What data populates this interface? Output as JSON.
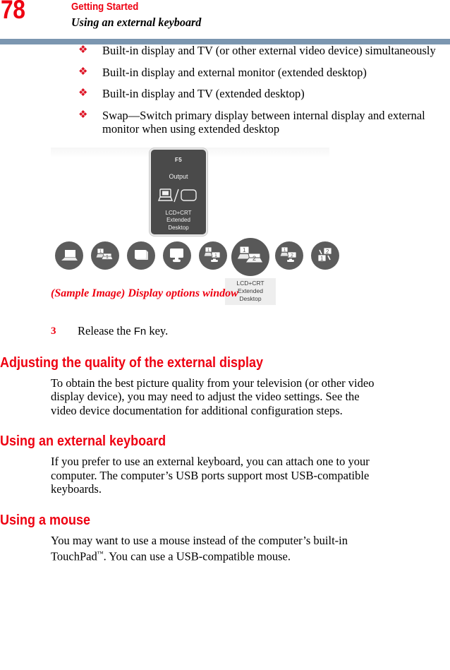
{
  "header": {
    "page_number": "78",
    "chapter": "Getting Started",
    "section": "Using an external keyboard",
    "rule_color": "#7b96b0",
    "accent_color": "#ee0011"
  },
  "bullets": [
    {
      "text": "Built-in display and TV (or other external video device) simultaneously"
    },
    {
      "text": "Built-in display and external monitor (extended desktop)"
    },
    {
      "text": "Built-in display and TV (extended desktop)"
    },
    {
      "text": "Swap—Switch primary display between internal display and external monitor when using extended desktop"
    }
  ],
  "figure": {
    "panel": {
      "key_label": "F5",
      "title": "Output",
      "mode_line1": "LCD+CRT",
      "mode_line2": "Extended",
      "mode_line3": "Desktop"
    },
    "icons": [
      {
        "name": "laptop-only-icon",
        "selected": false
      },
      {
        "name": "laptop-and-monitor-clone-icon",
        "selected": false
      },
      {
        "name": "monitor-only-icon",
        "selected": false
      },
      {
        "name": "tv-only-icon",
        "selected": false
      },
      {
        "name": "laptop-and-tv-clone-icon",
        "selected": false
      },
      {
        "name": "laptop-and-monitor-extended-icon",
        "selected": true
      },
      {
        "name": "laptop-and-tv-extended-icon",
        "selected": false
      },
      {
        "name": "swap-displays-icon",
        "selected": false
      }
    ],
    "tooltip": {
      "line1": "LCD+CRT",
      "line2": "Extended",
      "line3": "Desktop"
    },
    "caption": "(Sample Image) Display options window"
  },
  "step": {
    "number": "3",
    "text_before": "Release the ",
    "key": "Fn",
    "text_after": " key."
  },
  "sections": [
    {
      "heading": "Adjusting the quality of the external display",
      "body": "To obtain the best picture quality from your television (or other video display device), you may need to adjust the video settings. See the video device documentation for additional configuration steps."
    },
    {
      "heading": "Using an external keyboard",
      "body": "If you prefer to use an external keyboard, you can attach one to your computer. The computer’s USB ports support most USB-compatible keyboards."
    },
    {
      "heading": "Using a mouse",
      "body_before_tm": "You may want to use a mouse instead of the computer’s built-in TouchPad",
      "tm": "™",
      "body_after_tm": ". You can use a USB-compatible mouse."
    }
  ]
}
